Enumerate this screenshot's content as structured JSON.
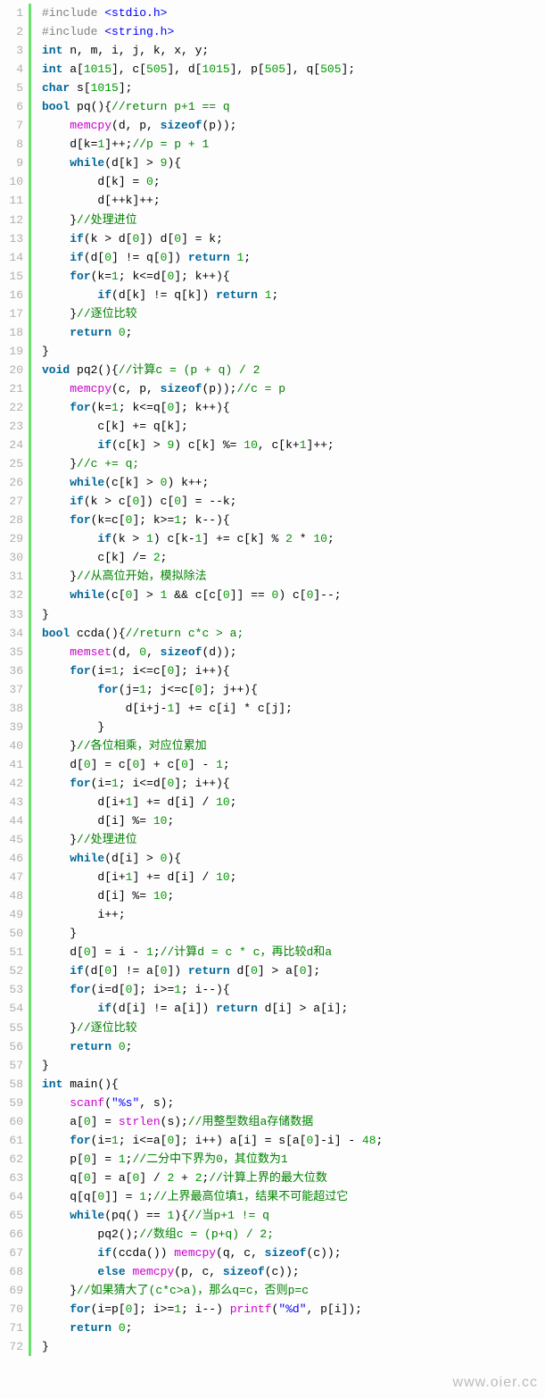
{
  "watermark": "www.oier.cc",
  "tokenClasses": {
    "preprocessor": [
      "#include"
    ],
    "keywords": [
      "int",
      "char",
      "bool",
      "void",
      "return",
      "if",
      "else",
      "for",
      "while",
      "sizeof"
    ],
    "functions": [
      "memcpy",
      "memset",
      "scanf",
      "printf",
      "strlen"
    ],
    "types": [],
    "strings": [
      "<stdio.h>",
      "<string.h>",
      "\"%s\"",
      "\"%d\""
    ]
  },
  "lines": [
    {
      "n": 1,
      "i": 0,
      "raw": "#include <stdio.h>"
    },
    {
      "n": 2,
      "i": 0,
      "raw": "#include <string.h>"
    },
    {
      "n": 3,
      "i": 0,
      "raw": "int n, m, i, j, k, x, y;"
    },
    {
      "n": 4,
      "i": 0,
      "raw": "int a[1015], c[505], d[1015], p[505], q[505];"
    },
    {
      "n": 5,
      "i": 0,
      "raw": "char s[1015];"
    },
    {
      "n": 6,
      "i": 0,
      "raw": "bool pq(){",
      "cm": "//return p+1 == q"
    },
    {
      "n": 7,
      "i": 1,
      "raw": "memcpy(d, p, sizeof(p));"
    },
    {
      "n": 8,
      "i": 1,
      "raw": "d[k=1]++;",
      "cm": "//p = p + 1"
    },
    {
      "n": 9,
      "i": 1,
      "raw": "while(d[k] > 9){"
    },
    {
      "n": 10,
      "i": 2,
      "raw": "d[k] = 0;"
    },
    {
      "n": 11,
      "i": 2,
      "raw": "d[++k]++;"
    },
    {
      "n": 12,
      "i": 1,
      "raw": "}",
      "cm": "//处理进位"
    },
    {
      "n": 13,
      "i": 1,
      "raw": "if(k > d[0]) d[0] = k;"
    },
    {
      "n": 14,
      "i": 1,
      "raw": "if(d[0] != q[0]) return 1;"
    },
    {
      "n": 15,
      "i": 1,
      "raw": "for(k=1; k<=d[0]; k++){"
    },
    {
      "n": 16,
      "i": 2,
      "raw": "if(d[k] != q[k]) return 1;"
    },
    {
      "n": 17,
      "i": 1,
      "raw": "}",
      "cm": "//逐位比较"
    },
    {
      "n": 18,
      "i": 1,
      "raw": "return 0;"
    },
    {
      "n": 19,
      "i": 0,
      "raw": "}"
    },
    {
      "n": 20,
      "i": 0,
      "raw": "void pq2(){",
      "cm": "//计算c = (p + q) / 2"
    },
    {
      "n": 21,
      "i": 1,
      "raw": "memcpy(c, p, sizeof(p));",
      "cm": "//c = p"
    },
    {
      "n": 22,
      "i": 1,
      "raw": "for(k=1; k<=q[0]; k++){"
    },
    {
      "n": 23,
      "i": 2,
      "raw": "c[k] += q[k];"
    },
    {
      "n": 24,
      "i": 2,
      "raw": "if(c[k] > 9) c[k] %= 10, c[k+1]++;"
    },
    {
      "n": 25,
      "i": 1,
      "raw": "}",
      "cm": "//c += q;"
    },
    {
      "n": 26,
      "i": 1,
      "raw": "while(c[k] > 0) k++;"
    },
    {
      "n": 27,
      "i": 1,
      "raw": "if(k > c[0]) c[0] = --k;"
    },
    {
      "n": 28,
      "i": 1,
      "raw": "for(k=c[0]; k>=1; k--){"
    },
    {
      "n": 29,
      "i": 2,
      "raw": "if(k > 1) c[k-1] += c[k] % 2 * 10;"
    },
    {
      "n": 30,
      "i": 2,
      "raw": "c[k] /= 2;"
    },
    {
      "n": 31,
      "i": 1,
      "raw": "}",
      "cm": "//从高位开始，模拟除法"
    },
    {
      "n": 32,
      "i": 1,
      "raw": "while(c[0] > 1 && c[c[0]] == 0) c[0]--;"
    },
    {
      "n": 33,
      "i": 0,
      "raw": "}"
    },
    {
      "n": 34,
      "i": 0,
      "raw": "bool ccda(){",
      "cm": "//return c*c > a;"
    },
    {
      "n": 35,
      "i": 1,
      "raw": "memset(d, 0, sizeof(d));"
    },
    {
      "n": 36,
      "i": 1,
      "raw": "for(i=1; i<=c[0]; i++){"
    },
    {
      "n": 37,
      "i": 2,
      "raw": "for(j=1; j<=c[0]; j++){"
    },
    {
      "n": 38,
      "i": 3,
      "raw": "d[i+j-1] += c[i] * c[j];"
    },
    {
      "n": 39,
      "i": 2,
      "raw": "}"
    },
    {
      "n": 40,
      "i": 1,
      "raw": "}",
      "cm": "//各位相乘，对应位累加"
    },
    {
      "n": 41,
      "i": 1,
      "raw": "d[0] = c[0] + c[0] - 1;"
    },
    {
      "n": 42,
      "i": 1,
      "raw": "for(i=1; i<=d[0]; i++){"
    },
    {
      "n": 43,
      "i": 2,
      "raw": "d[i+1] += d[i] / 10;"
    },
    {
      "n": 44,
      "i": 2,
      "raw": "d[i] %= 10;"
    },
    {
      "n": 45,
      "i": 1,
      "raw": "}",
      "cm": "//处理进位"
    },
    {
      "n": 46,
      "i": 1,
      "raw": "while(d[i] > 0){"
    },
    {
      "n": 47,
      "i": 2,
      "raw": "d[i+1] += d[i] / 10;"
    },
    {
      "n": 48,
      "i": 2,
      "raw": "d[i] %= 10;"
    },
    {
      "n": 49,
      "i": 2,
      "raw": "i++;"
    },
    {
      "n": 50,
      "i": 1,
      "raw": "}"
    },
    {
      "n": 51,
      "i": 1,
      "raw": "d[0] = i - 1;",
      "cm": "//计算d = c * c，再比较d和a"
    },
    {
      "n": 52,
      "i": 1,
      "raw": "if(d[0] != a[0]) return d[0] > a[0];"
    },
    {
      "n": 53,
      "i": 1,
      "raw": "for(i=d[0]; i>=1; i--){"
    },
    {
      "n": 54,
      "i": 2,
      "raw": "if(d[i] != a[i]) return d[i] > a[i];"
    },
    {
      "n": 55,
      "i": 1,
      "raw": "}",
      "cm": "//逐位比较"
    },
    {
      "n": 56,
      "i": 1,
      "raw": "return 0;"
    },
    {
      "n": 57,
      "i": 0,
      "raw": "}"
    },
    {
      "n": 58,
      "i": 0,
      "raw": "int main(){"
    },
    {
      "n": 59,
      "i": 1,
      "raw": "scanf(\"%s\", s);"
    },
    {
      "n": 60,
      "i": 1,
      "raw": "a[0] = strlen(s);",
      "cm": "//用整型数组a存储数据"
    },
    {
      "n": 61,
      "i": 1,
      "raw": "for(i=1; i<=a[0]; i++) a[i] = s[a[0]-i] - 48;"
    },
    {
      "n": 62,
      "i": 1,
      "raw": "p[0] = 1;",
      "cm": "//二分中下界为0，其位数为1"
    },
    {
      "n": 63,
      "i": 1,
      "raw": "q[0] = a[0] / 2 + 2;",
      "cm": "//计算上界的最大位数"
    },
    {
      "n": 64,
      "i": 1,
      "raw": "q[q[0]] = 1;",
      "cm": "//上界最高位填1，结果不可能超过它"
    },
    {
      "n": 65,
      "i": 1,
      "raw": "while(pq() == 1){",
      "cm": "//当p+1 != q"
    },
    {
      "n": 66,
      "i": 2,
      "raw": "pq2();",
      "cm": "//数组c = (p+q) / 2;"
    },
    {
      "n": 67,
      "i": 2,
      "raw": "if(ccda()) memcpy(q, c, sizeof(c));"
    },
    {
      "n": 68,
      "i": 2,
      "raw": "else memcpy(p, c, sizeof(c));"
    },
    {
      "n": 69,
      "i": 1,
      "raw": "}",
      "cm": "//如果猜大了(c*c>a)，那么q=c，否则p=c"
    },
    {
      "n": 70,
      "i": 1,
      "raw": "for(i=p[0]; i>=1; i--) printf(\"%d\", p[i]);"
    },
    {
      "n": 71,
      "i": 1,
      "raw": "return 0;"
    },
    {
      "n": 72,
      "i": 0,
      "raw": "}"
    }
  ]
}
